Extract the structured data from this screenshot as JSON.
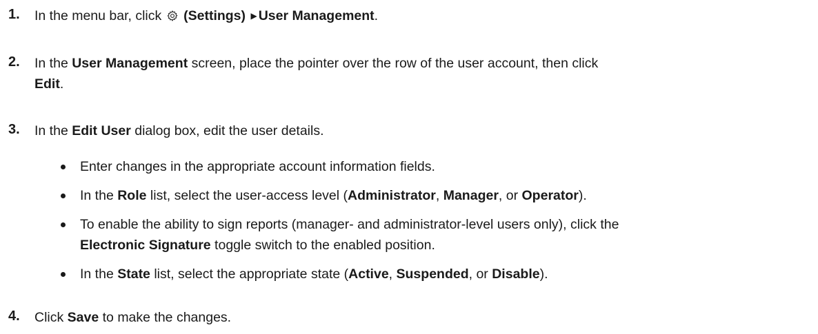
{
  "steps": [
    {
      "num": "1.",
      "a": "In the menu bar, click ",
      "b": "(Settings)",
      "c": "User Management",
      "d": ".",
      "icon": "gear-icon"
    },
    {
      "num": "2.",
      "a": "In the ",
      "b": "User Management",
      "c": " screen, place the pointer over the row of the user account, then click",
      "d": "Edit",
      "e": "."
    },
    {
      "num": "3.",
      "a": "In the ",
      "b": "Edit User",
      "c": " dialog box, edit the user details."
    },
    {
      "num": "4.",
      "a": "Click ",
      "b": "Save",
      "c": " to make the changes."
    }
  ],
  "bullets": [
    {
      "a": "Enter changes in the appropriate account information fields."
    },
    {
      "a": "In the ",
      "b": "Role",
      "c": " list, select the user-access level (",
      "d": "Administrator",
      "e": ", ",
      "f": "Manager",
      "g": ", or ",
      "h": "Operator",
      "i": ")."
    },
    {
      "a": "To enable the ability to sign reports (manager- and administrator-level users only), click the",
      "b": "Electronic Signature",
      "c": " toggle switch to the enabled position."
    },
    {
      "a": "In the ",
      "b": "State",
      "c": " list, select the appropriate state (",
      "d": "Active",
      "e": ", ",
      "f": "Suspended",
      "g": ", or ",
      "h": "Disable",
      "i": ")."
    }
  ]
}
